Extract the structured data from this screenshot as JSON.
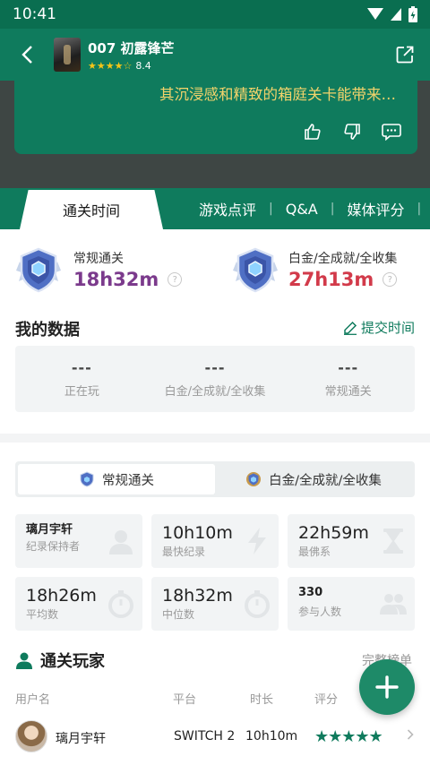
{
  "status_bar": {
    "time": "10:41"
  },
  "header": {
    "game_title": "007 初露锋芒",
    "rating": "8.4",
    "rating_stars": "★★★★☆"
  },
  "review": {
    "text": "其沉浸感和精致的箱庭关卡能带来…"
  },
  "tabs": [
    {
      "label": "通关时间",
      "active": true
    },
    {
      "label": "游戏点评"
    },
    {
      "label": "Q&A"
    },
    {
      "label": "媒体评分"
    }
  ],
  "tab_separator": "|",
  "summary": {
    "regular": {
      "label": "常规通关",
      "value": "18h32m",
      "color": "#7b3a8c"
    },
    "platinum": {
      "label": "白金/全成就/全收集",
      "value": "27h13m",
      "color": "#d23a4a"
    },
    "help_glyph": "?"
  },
  "my_data": {
    "title": "我的数据",
    "submit_label": "提交时间",
    "items": [
      {
        "value": "---",
        "label": "正在玩"
      },
      {
        "value": "---",
        "label": "白金/全成就/全收集"
      },
      {
        "value": "---",
        "label": "常规通关"
      }
    ]
  },
  "segment": {
    "options": [
      {
        "label": "常规通关",
        "active": true
      },
      {
        "label": "白金/全成就/全收集",
        "active": false
      }
    ]
  },
  "stats": [
    {
      "value": "璃月宇轩",
      "label": "纪录保持者",
      "icon": "person-icon",
      "small": true
    },
    {
      "value": "10h10m",
      "label": "最快纪录",
      "icon": "lightning-icon"
    },
    {
      "value": "22h59m",
      "label": "最佛系",
      "icon": "hourglass-icon"
    },
    {
      "value": "18h26m",
      "label": "平均数",
      "icon": "stopwatch-icon"
    },
    {
      "value": "18h32m",
      "label": "中位数",
      "icon": "stopwatch-icon"
    },
    {
      "value": "330",
      "label": "参与人数",
      "icon": "people-icon",
      "small": true
    }
  ],
  "players": {
    "title": "通关玩家",
    "full_rank": "完整榜单",
    "columns": {
      "user": "用户名",
      "platform": "平台",
      "duration": "时长",
      "score": "评分"
    },
    "rows": [
      {
        "name": "璃月宇轩",
        "platform": "SWITCH 2",
        "duration": "10h10m",
        "stars": "★★★★★",
        "rating_fraction": 0.9
      }
    ]
  },
  "colors": {
    "primary": "#0f7b5d",
    "accent_gold": "#f2d36b"
  }
}
